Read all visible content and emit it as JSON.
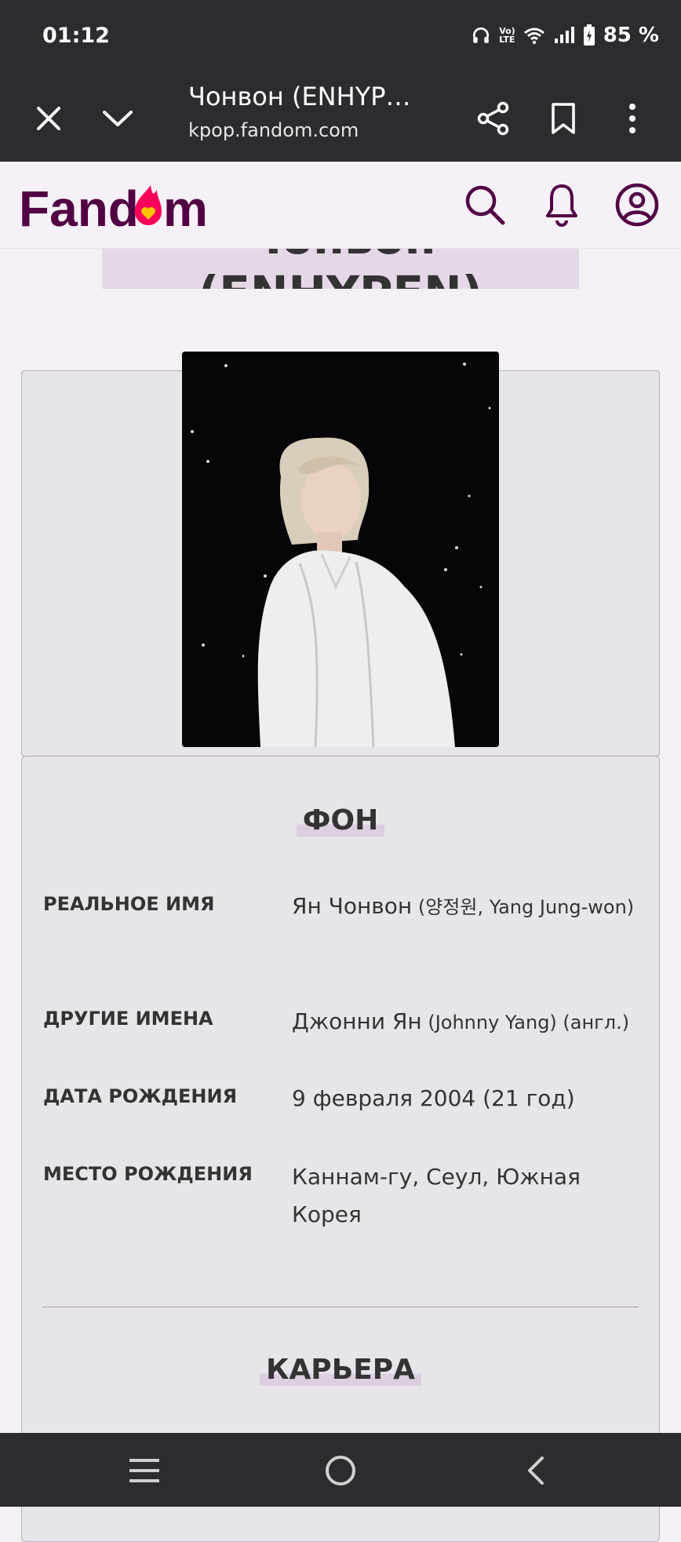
{
  "status_bar": {
    "time": "01:12",
    "battery": "85 %",
    "icons": [
      "headphones-icon",
      "volte-icon",
      "wifi-icon",
      "signal-icon",
      "battery-icon"
    ]
  },
  "browser": {
    "page_title": "Чонвон (ENHYP…",
    "url": "kpop.fandom.com",
    "icons": [
      "close-icon",
      "chevron-down-icon",
      "share-icon",
      "bookmark-icon",
      "more-vert-icon"
    ]
  },
  "site_header": {
    "logo_text": "Fandom",
    "icons": [
      "search-icon",
      "bell-icon",
      "user-icon"
    ]
  },
  "article": {
    "heading": "Чонвон (ENHYPEN)"
  },
  "infobox": {
    "section_background": "ФОН",
    "rows": [
      {
        "label": "РЕАЛЬНОЕ ИМЯ",
        "value_main": "Ян Чонвон",
        "value_extra": " (양정원, Yang Jung-won)"
      },
      {
        "label": "ДРУГИЕ ИМЕНА",
        "value_main": "Джонни Ян",
        "value_extra": " (Johnny Yang) (англ.)"
      },
      {
        "label": "ДАТА РОЖДЕНИЯ",
        "value_main": "9 февраля 2004 (21 год)",
        "value_extra": ""
      },
      {
        "label": "МЕСТО РОЖДЕНИЯ",
        "value_main": "Каннам-гу, Сеул, Южная Корея",
        "value_extra": ""
      }
    ],
    "section_career": "КАРЬЕРА"
  },
  "navbar": {
    "icons": [
      "menu-icon",
      "home-icon",
      "back-icon"
    ]
  },
  "colors": {
    "bar_dark": "#2c2b30",
    "fandom_purple": "#520044",
    "fandom_orange": "#fa005a",
    "infobox_bg": "#e8e5ea",
    "infobox_border": "#b8a9c4"
  }
}
